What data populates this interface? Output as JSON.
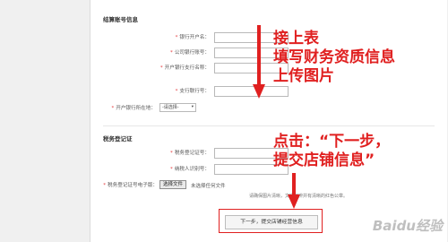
{
  "form": {
    "section_bank": "结算账号信息",
    "bank_fields": [
      {
        "label": "银行开户名："
      },
      {
        "label": "公司银行账号："
      },
      {
        "label": "开户银行支行名称："
      },
      {
        "label": "支行联行号："
      }
    ],
    "bank_location": {
      "label": "开户银行所在地：",
      "select_value": "-请选择-"
    },
    "section_tax": "税务登记证",
    "tax_fields": [
      {
        "label": "税务登记证号："
      },
      {
        "label": "纳税人识别号："
      }
    ],
    "tax_upload": {
      "label": "税务登记证号电子版：",
      "button": "选择文件",
      "status": "未选择任何文件",
      "note": "请确保图片清晰，文字可辨并有清晰的红色公章。"
    },
    "submit_button": "下一步，提交店铺经营信息"
  },
  "annotations": {
    "top_lines": [
      "接上表",
      "填写财务资质信息",
      "上传图片"
    ],
    "bottom_lines": [
      "点击：“下一步，",
      "提交店铺信息”"
    ],
    "color": "#e02020"
  },
  "watermark": "Baidu经验",
  "colors": {
    "required_star": "#e4393c",
    "annotation_red": "#e02020"
  }
}
